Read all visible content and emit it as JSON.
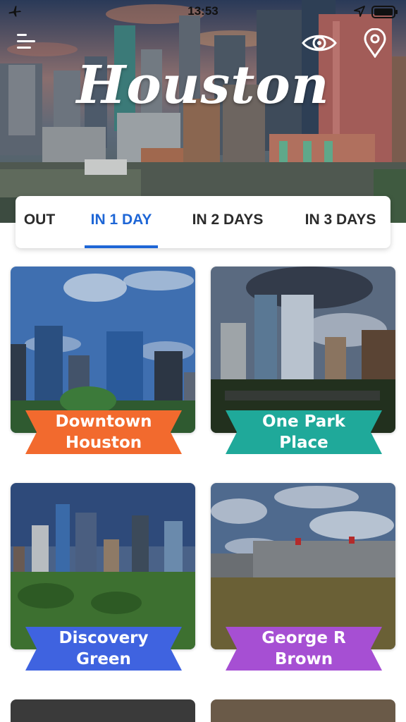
{
  "status_bar": {
    "time": "13:53"
  },
  "hero": {
    "title": "Houston"
  },
  "tabs": [
    {
      "label": "OUT",
      "active": false
    },
    {
      "label": "IN 1 DAY",
      "active": true
    },
    {
      "label": "IN 2 DAYS",
      "active": false
    },
    {
      "label": "IN 3 DAYS",
      "active": false
    }
  ],
  "cards": [
    {
      "line1": "Downtown",
      "line2": "Houston",
      "ribbon_color": "#f26a2e"
    },
    {
      "line1": "One Park",
      "line2": "Place",
      "ribbon_color": "#1fa99a"
    },
    {
      "line1": "Discovery",
      "line2": "Green",
      "ribbon_color": "#3f63e0"
    },
    {
      "line1": "George R",
      "line2": "Brown",
      "ribbon_color": "#a64fd3"
    }
  ],
  "colors": {
    "accent": "#1e66d6",
    "text": "#2b2b2b"
  },
  "icons": [
    "airplane-icon",
    "location-arrow-icon",
    "battery-icon",
    "menu-icon",
    "eye-icon",
    "map-pin-icon"
  ]
}
